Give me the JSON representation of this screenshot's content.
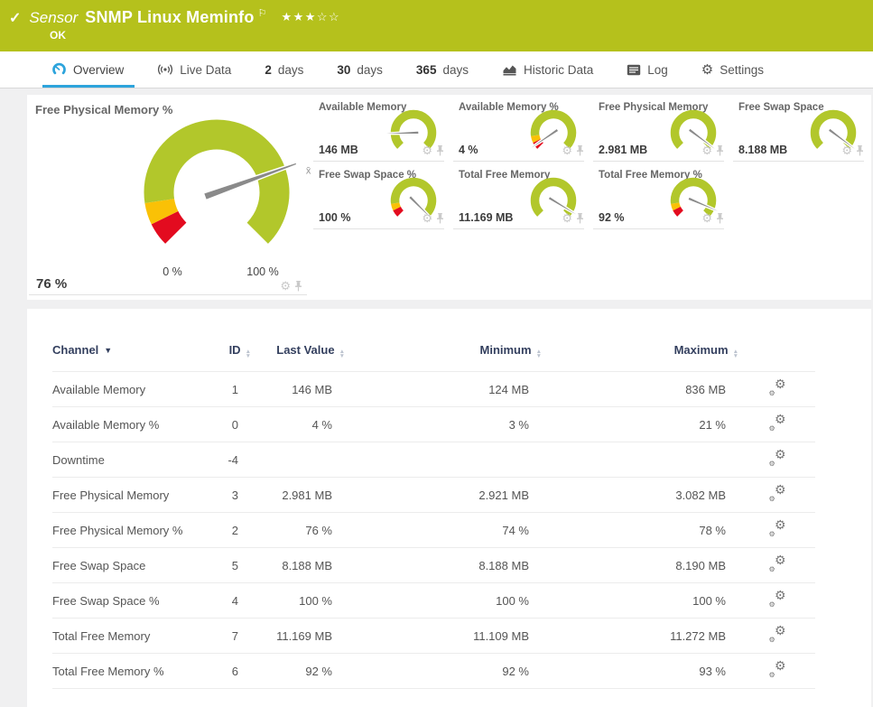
{
  "header": {
    "kind_label": "Sensor",
    "title": "SNMP Linux Meminfo",
    "status": "OK",
    "rating": {
      "filled": 3,
      "total": 5
    }
  },
  "tabs": [
    {
      "label": "Overview",
      "icon": "gauge",
      "active": true
    },
    {
      "label": "Live Data",
      "icon": "live"
    },
    {
      "num": "2",
      "label": "days"
    },
    {
      "num": "30",
      "label": "days"
    },
    {
      "num": "365",
      "label": "days"
    },
    {
      "label": "Historic Data",
      "icon": "chart"
    },
    {
      "label": "Log",
      "icon": "log"
    },
    {
      "label": "Settings",
      "icon": "gear"
    }
  ],
  "main_gauge": {
    "title": "Free Physical Memory %",
    "value": "76 %",
    "scale_min": "0 %",
    "scale_max": "100 %",
    "needle_percent": 76,
    "warn_segments": true,
    "mean_marker": "x̄"
  },
  "small_gauges": [
    {
      "title": "Available Memory",
      "value": "146 MB",
      "needle_percent": 16,
      "warn_segments": false
    },
    {
      "title": "Available Memory %",
      "value": "4 %",
      "needle_percent": 4,
      "warn_segments": true
    },
    {
      "title": "Free Physical Memory",
      "value": "2.981 MB",
      "needle_percent": 97,
      "warn_segments": false
    },
    {
      "title": "Free Swap Space",
      "value": "8.188 MB",
      "needle_percent": 97,
      "warn_segments": false
    },
    {
      "title": "Free Swap Space %",
      "value": "100 %",
      "needle_percent": 100,
      "warn_segments": true
    },
    {
      "title": "Total Free Memory",
      "value": "11.169 MB",
      "needle_percent": 95,
      "warn_segments": false
    },
    {
      "title": "Total Free Memory %",
      "value": "92 %",
      "needle_percent": 92,
      "warn_segments": true
    }
  ],
  "table": {
    "columns": [
      "Channel",
      "ID",
      "Last Value",
      "Minimum",
      "Maximum"
    ],
    "rows": [
      {
        "channel": "Available Memory",
        "id": "1",
        "last": "146 MB",
        "min": "124 MB",
        "max": "836 MB"
      },
      {
        "channel": "Available Memory %",
        "id": "0",
        "last": "4 %",
        "min": "3 %",
        "max": "21 %"
      },
      {
        "channel": "Downtime",
        "id": "-4",
        "last": "",
        "min": "",
        "max": ""
      },
      {
        "channel": "Free Physical Memory",
        "id": "3",
        "last": "2.981 MB",
        "min": "2.921 MB",
        "max": "3.082 MB"
      },
      {
        "channel": "Free Physical Memory %",
        "id": "2",
        "last": "76 %",
        "min": "74 %",
        "max": "78 %"
      },
      {
        "channel": "Free Swap Space",
        "id": "5",
        "last": "8.188 MB",
        "min": "8.188 MB",
        "max": "8.190 MB"
      },
      {
        "channel": "Free Swap Space %",
        "id": "4",
        "last": "100 %",
        "min": "100 %",
        "max": "100 %"
      },
      {
        "channel": "Total Free Memory",
        "id": "7",
        "last": "11.169 MB",
        "min": "11.109 MB",
        "max": "11.272 MB"
      },
      {
        "channel": "Total Free Memory %",
        "id": "6",
        "last": "92 %",
        "min": "92 %",
        "max": "93 %"
      }
    ]
  },
  "icons": {
    "check": "✓",
    "flag": "⚐",
    "star_filled": "★",
    "star_empty": "☆",
    "gear": "⚙",
    "sort_up": "▲",
    "sort_down": "▼",
    "sort_caret": "▼"
  },
  "colors": {
    "header_green": "#b5c11c",
    "gauge_green": "#b2c72b",
    "gauge_yellow": "#fac106",
    "gauge_red": "#e30b1f",
    "needle_gray": "#8a8a8a",
    "accent_blue": "#2da4dc",
    "table_header_navy": "#333f5e"
  }
}
